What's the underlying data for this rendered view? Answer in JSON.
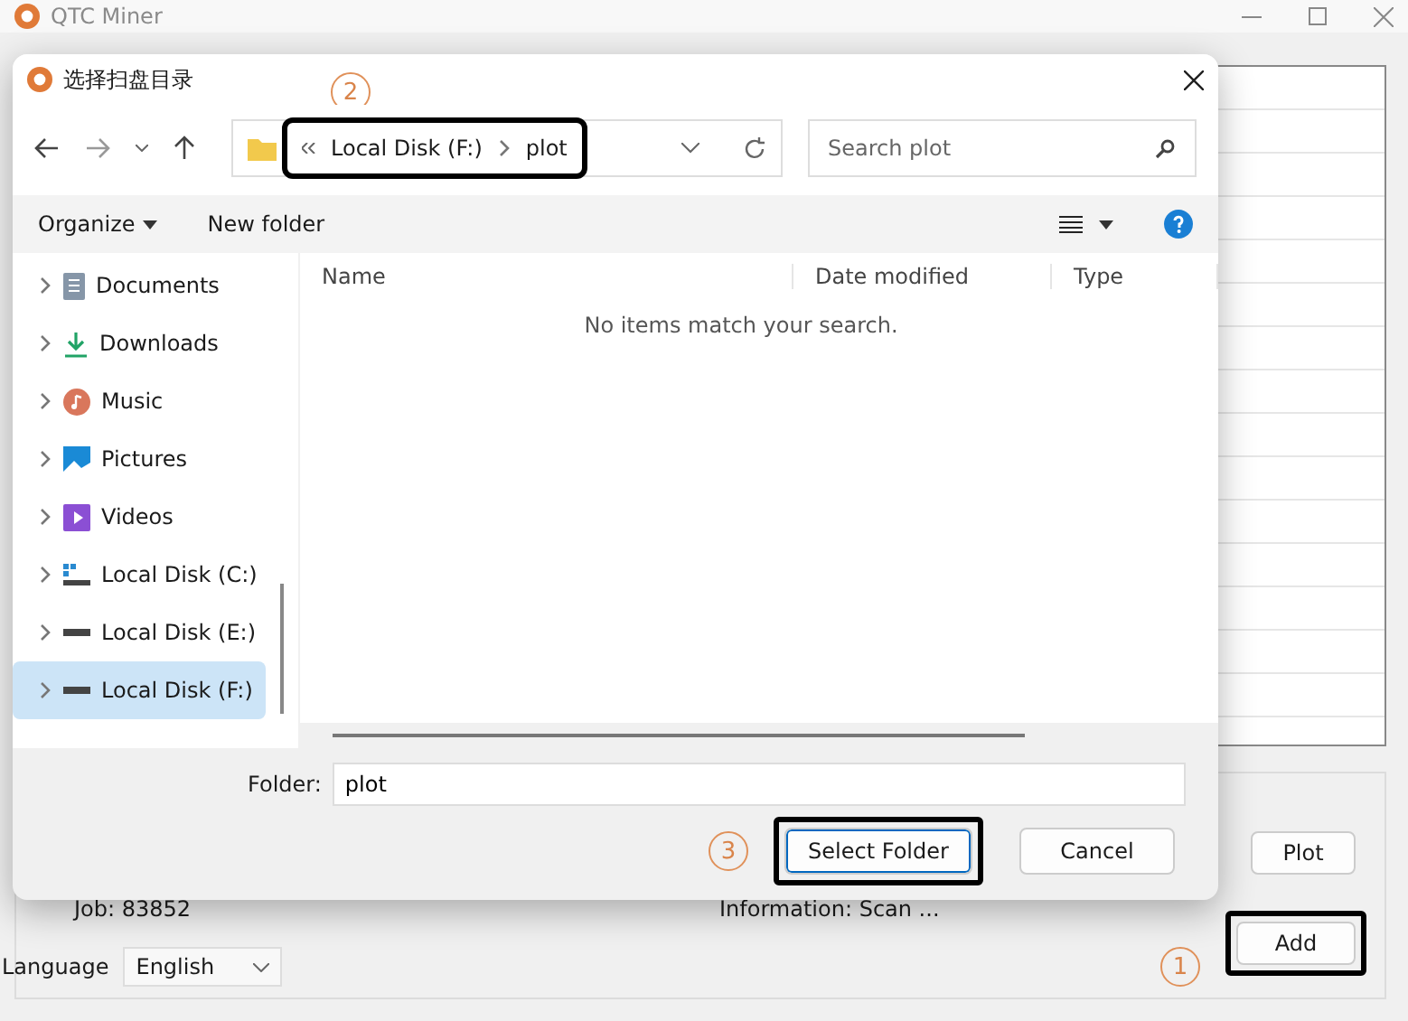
{
  "window": {
    "title": "QTC Miner"
  },
  "main": {
    "job": "Job: 83852",
    "information": "Information: Scan ...",
    "language_label": "Language",
    "language_value": "English",
    "buttons": [
      {
        "label": "Plot",
        "highlighted": false
      },
      {
        "label": "Add",
        "highlighted": true,
        "callout": "1"
      }
    ]
  },
  "dialog": {
    "title": "选择扫盘目录",
    "title_callout": "2",
    "address": {
      "crumbs": [
        "Local Disk (F:)",
        "plot"
      ],
      "highlighted": true
    },
    "search": {
      "placeholder": "Search plot"
    },
    "commands": [
      "Organize",
      "New folder"
    ],
    "sidebar": [
      {
        "label": "Documents",
        "kind": "documents",
        "selected": false
      },
      {
        "label": "Downloads",
        "kind": "downloads",
        "selected": false
      },
      {
        "label": "Music",
        "kind": "music",
        "selected": false
      },
      {
        "label": "Pictures",
        "kind": "pictures",
        "selected": false
      },
      {
        "label": "Videos",
        "kind": "videos",
        "selected": false
      },
      {
        "label": "Local Disk (C:)",
        "kind": "system_drive",
        "selected": false
      },
      {
        "label": "Local Disk (E:)",
        "kind": "drive",
        "selected": false
      },
      {
        "label": "Local Disk (F:)",
        "kind": "drive",
        "selected": true
      }
    ],
    "columns": [
      "Name",
      "Date modified",
      "Type"
    ],
    "empty_message": "No items match your search.",
    "folder_label": "Folder:",
    "folder_value": "plot",
    "buttons": [
      {
        "label": "Select Folder",
        "highlighted": true,
        "callout": "3"
      },
      {
        "label": "Cancel",
        "highlighted": false
      }
    ]
  }
}
